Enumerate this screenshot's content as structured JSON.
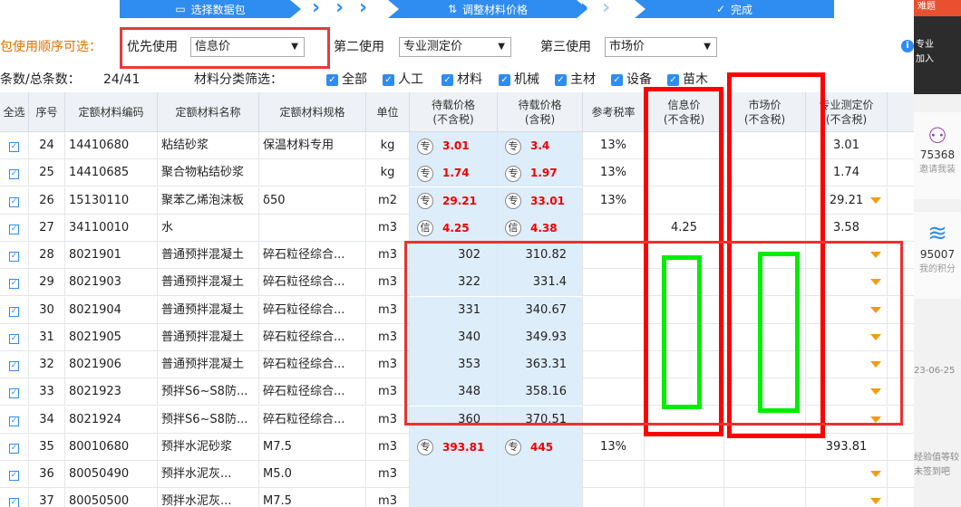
{
  "steps": {
    "step1": "选择数据包",
    "step2": "调整材料价格",
    "step3": "完成"
  },
  "priority": {
    "label": "包使用顺序可选：",
    "first_label": "优先使用",
    "first_value": "信息价",
    "second_label": "第二使用",
    "second_value": "专业测定价",
    "third_label": "第三使用",
    "third_value": "市场价"
  },
  "count": {
    "label": "条数/总条数：",
    "value": "24/41"
  },
  "filter": {
    "label": "材料分类筛选：",
    "options": [
      "全部",
      "人工",
      "材料",
      "机械",
      "主材",
      "设备",
      "苗木"
    ]
  },
  "columns": {
    "select_all": "全选",
    "seq": "序号",
    "code": "定额材料编码",
    "name": "定额材料名称",
    "spec": "定额材料规格",
    "unit": "单位",
    "price_ex": [
      "待载价格",
      "(不含税)"
    ],
    "price_in": [
      "待载价格",
      "(含税)"
    ],
    "tax": "参考税率",
    "info": [
      "信息价",
      "(不含税)"
    ],
    "market": [
      "市场价",
      "(不含税)"
    ],
    "pro": [
      "专业测定价",
      "(不含税)"
    ]
  },
  "rows": [
    {
      "seq": "24",
      "code": "14410680",
      "name": "粘结砂浆",
      "spec": "保温材料专用",
      "unit": "kg",
      "tag": "专",
      "ex": "3.01",
      "in": "3.4",
      "tax": "13%",
      "info": "",
      "market": "",
      "pro": "3.01",
      "flag": false
    },
    {
      "seq": "25",
      "code": "14410685",
      "name": "聚合物粘结砂浆",
      "spec": "",
      "unit": "kg",
      "tag": "专",
      "ex": "1.74",
      "in": "1.97",
      "tax": "13%",
      "info": "",
      "market": "",
      "pro": "1.74",
      "flag": false
    },
    {
      "seq": "26",
      "code": "15130110",
      "name": "聚苯乙烯泡沫板",
      "spec": "δ50",
      "unit": "m2",
      "tag": "专",
      "ex": "29.21",
      "in": "33.01",
      "tax": "13%",
      "info": "",
      "market": "",
      "pro": "29.21",
      "flag": true
    },
    {
      "seq": "27",
      "code": "34110010",
      "name": "水",
      "spec": "",
      "unit": "m3",
      "tag": "信",
      "ex": "4.25",
      "in": "4.38",
      "tax": "",
      "info": "4.25",
      "market": "",
      "pro": "3.58",
      "flag": false
    },
    {
      "seq": "28",
      "code": "8021901",
      "name": "普通预拌混凝土",
      "spec": "碎石粒径综合...",
      "unit": "m3",
      "tag": "",
      "ex": "302",
      "in": "310.82",
      "tax": "",
      "info": "",
      "market": "",
      "pro": "",
      "flag": true
    },
    {
      "seq": "29",
      "code": "8021903",
      "name": "普通预拌混凝土",
      "spec": "碎石粒径综合...",
      "unit": "m3",
      "tag": "",
      "ex": "322",
      "in": "331.4",
      "tax": "",
      "info": "",
      "market": "",
      "pro": "",
      "flag": true
    },
    {
      "seq": "30",
      "code": "8021904",
      "name": "普通预拌混凝土",
      "spec": "碎石粒径综合...",
      "unit": "m3",
      "tag": "",
      "ex": "331",
      "in": "340.67",
      "tax": "",
      "info": "",
      "market": "",
      "pro": "",
      "flag": true
    },
    {
      "seq": "31",
      "code": "8021905",
      "name": "普通预拌混凝土",
      "spec": "碎石粒径综合...",
      "unit": "m3",
      "tag": "",
      "ex": "340",
      "in": "349.93",
      "tax": "",
      "info": "",
      "market": "",
      "pro": "",
      "flag": true
    },
    {
      "seq": "32",
      "code": "8021906",
      "name": "普通预拌混凝土",
      "spec": "碎石粒径综合...",
      "unit": "m3",
      "tag": "",
      "ex": "353",
      "in": "363.31",
      "tax": "",
      "info": "",
      "market": "",
      "pro": "",
      "flag": true
    },
    {
      "seq": "33",
      "code": "8021923",
      "name": "预拌S6~S8防...",
      "spec": "碎石粒径综合...",
      "unit": "m3",
      "tag": "",
      "ex": "348",
      "in": "358.16",
      "tax": "",
      "info": "",
      "market": "",
      "pro": "",
      "flag": true
    },
    {
      "seq": "34",
      "code": "8021924",
      "name": "预拌S6~S8防...",
      "spec": "碎石粒径综合...",
      "unit": "m3",
      "tag": "",
      "ex": "360",
      "in": "370.51",
      "tax": "",
      "info": "",
      "market": "",
      "pro": "",
      "flag": true
    },
    {
      "seq": "35",
      "code": "80010680",
      "name": "预拌水泥砂浆",
      "spec": "M7.5",
      "unit": "m3",
      "tag": "专",
      "ex": "393.81",
      "in": "445",
      "tax": "13%",
      "info": "",
      "market": "",
      "pro": "393.81",
      "flag": false
    },
    {
      "seq": "36",
      "code": "80050490",
      "name": "预拌水泥灰...",
      "spec": "M5.0",
      "unit": "m3",
      "tag": "",
      "ex": "",
      "in": "",
      "tax": "",
      "info": "",
      "market": "",
      "pro": "",
      "flag": true
    },
    {
      "seq": "37",
      "code": "80050500",
      "name": "预拌水泥灰...",
      "spec": "M7.5",
      "unit": "m3",
      "tag": "",
      "ex": "",
      "in": "",
      "tax": "",
      "info": "",
      "market": "",
      "pro": "",
      "flag": true
    }
  ],
  "side": {
    "top": "难题",
    "dark1": "专业",
    "dark2": "加入",
    "num1": "75368",
    "sub1": "邀请我装",
    "num2": "95007",
    "sub2": "我的积分",
    "date": "23-06-25",
    "note1": "经验值等较",
    "note2": "未签到吧"
  },
  "colors": {
    "accent": "#2f8cf0",
    "annotation_red": "#ff0000",
    "annotation_green": "#00ee00",
    "price_red": "#e00000"
  }
}
